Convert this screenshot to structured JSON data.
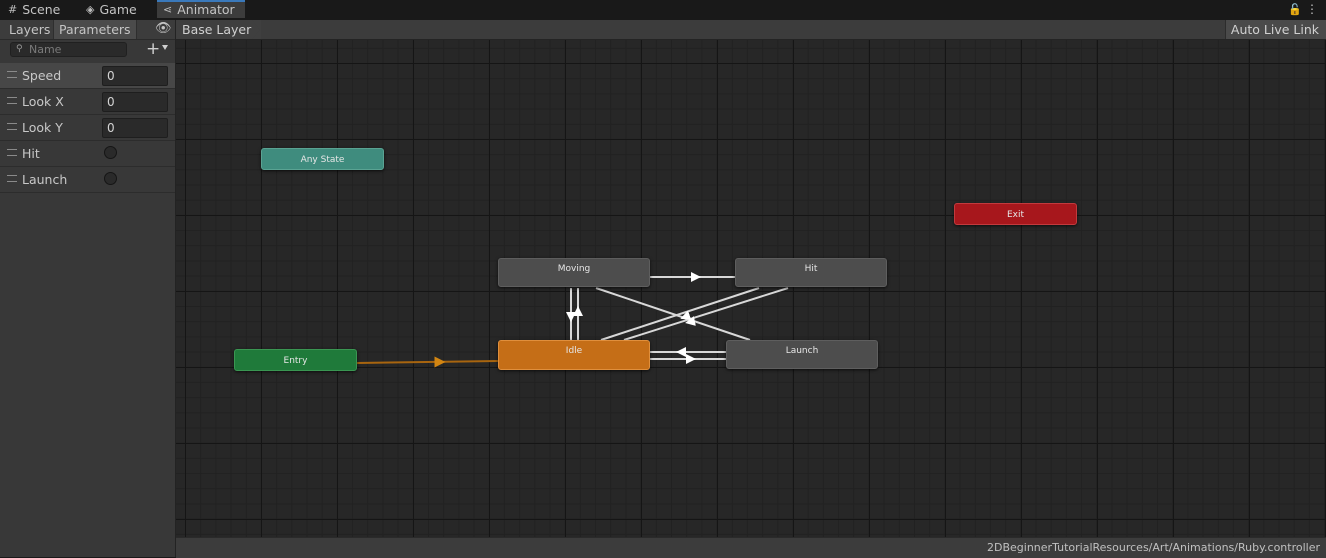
{
  "tabs": {
    "scene": {
      "label": "Scene",
      "icon": "grid-icon"
    },
    "game": {
      "label": "Game",
      "icon": "gamepad-icon"
    },
    "animator": {
      "label": "Animator",
      "icon": "animator-icon",
      "active": true
    }
  },
  "window_controls": {
    "lock_icon": "lock-icon",
    "menu_icon": "kebab-menu-icon"
  },
  "left_panel": {
    "tabs": {
      "layers": "Layers",
      "parameters": "Parameters"
    },
    "search_placeholder": "Name",
    "parameters": [
      {
        "name": "Speed",
        "type": "float",
        "value": "0"
      },
      {
        "name": "Look X",
        "type": "float",
        "value": "0"
      },
      {
        "name": "Look Y",
        "type": "float",
        "value": "0"
      },
      {
        "name": "Hit",
        "type": "trigger"
      },
      {
        "name": "Launch",
        "type": "trigger"
      }
    ]
  },
  "graph_toolbar": {
    "breadcrumb": "Base Layer",
    "live_link": "Auto Live Link"
  },
  "states": {
    "any_state": "Any State",
    "exit": "Exit",
    "entry": "Entry",
    "moving": "Moving",
    "hit": "Hit",
    "launch": "Launch",
    "idle": "Idle"
  },
  "colors": {
    "any_state": "#3f8c7e",
    "exit": "#a7171c",
    "entry": "#1f7a3a",
    "default_state": "#c56e17",
    "state": "#4d4d4d",
    "entry_transition": "#c67a12",
    "transition": "#d8d8d8",
    "active_tab_accent": "#3a79bb"
  },
  "status": {
    "asset_path": "2DBeginnerTutorialResources/Art/Animations/Ruby.controller"
  }
}
